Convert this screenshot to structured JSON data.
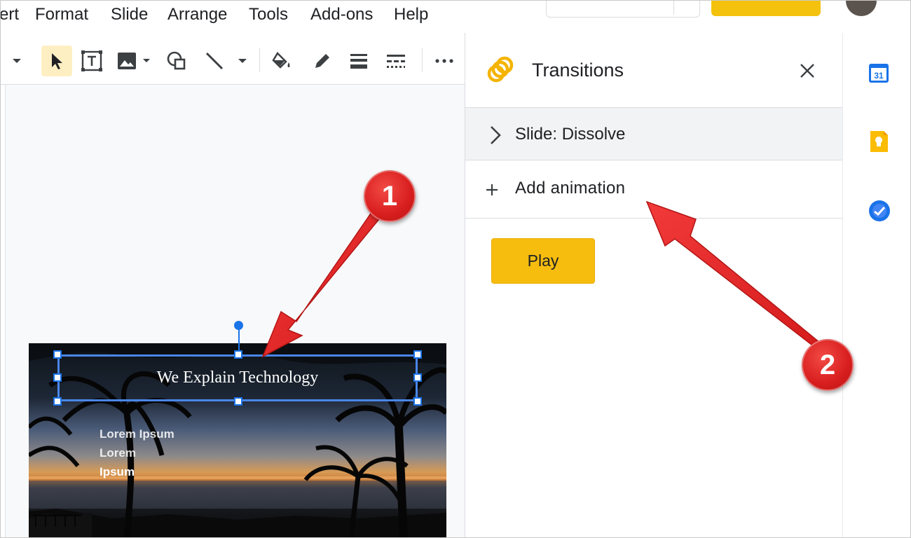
{
  "menu": {
    "items": [
      "ert",
      "Format",
      "Slide",
      "Arrange",
      "Tools",
      "Add-ons",
      "Help"
    ]
  },
  "toolbar": {
    "icons": [
      "dropdown-icon",
      "select-cursor-icon",
      "text-box-icon",
      "image-icon",
      "shape-icon",
      "line-icon",
      "fill-color-icon",
      "border-color-icon",
      "border-weight-icon",
      "border-dash-icon",
      "more-icon"
    ]
  },
  "slide": {
    "title": "We Explain Technology",
    "body_lines": [
      "Lorem Ipsum",
      "Lorem",
      "Ipsum"
    ]
  },
  "panel": {
    "title": "Transitions",
    "slide_transition": "Slide: Dissolve",
    "add_animation": "Add animation",
    "play_label": "Play"
  },
  "rightbar": {
    "calendar_day": "31"
  },
  "annotations": {
    "badge1": "1",
    "badge2": "2"
  },
  "colors": {
    "accent_yellow": "#f6bd0f",
    "selection_blue": "#1a73e8",
    "annotation_red": "#e02424"
  }
}
